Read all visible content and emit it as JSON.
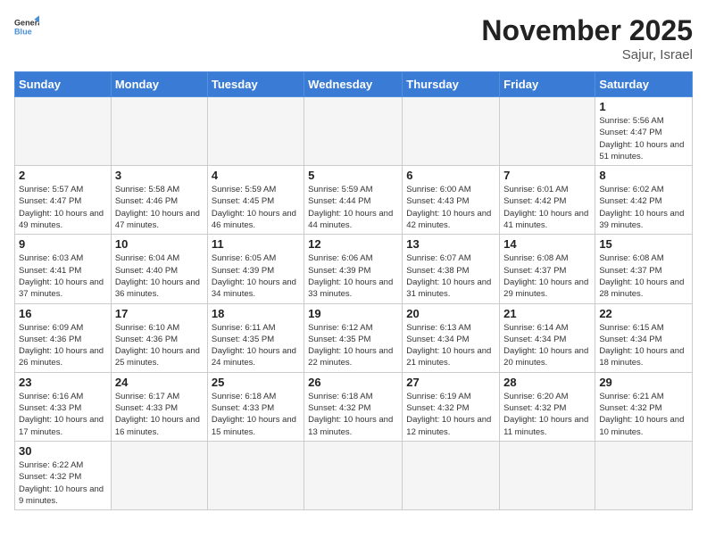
{
  "header": {
    "logo_general": "General",
    "logo_blue": "Blue",
    "month_title": "November 2025",
    "location": "Sajur, Israel"
  },
  "weekdays": [
    "Sunday",
    "Monday",
    "Tuesday",
    "Wednesday",
    "Thursday",
    "Friday",
    "Saturday"
  ],
  "weeks": [
    [
      {
        "day": "",
        "info": ""
      },
      {
        "day": "",
        "info": ""
      },
      {
        "day": "",
        "info": ""
      },
      {
        "day": "",
        "info": ""
      },
      {
        "day": "",
        "info": ""
      },
      {
        "day": "",
        "info": ""
      },
      {
        "day": "1",
        "info": "Sunrise: 5:56 AM\nSunset: 4:47 PM\nDaylight: 10 hours and 51 minutes."
      }
    ],
    [
      {
        "day": "2",
        "info": "Sunrise: 5:57 AM\nSunset: 4:47 PM\nDaylight: 10 hours and 49 minutes."
      },
      {
        "day": "3",
        "info": "Sunrise: 5:58 AM\nSunset: 4:46 PM\nDaylight: 10 hours and 47 minutes."
      },
      {
        "day": "4",
        "info": "Sunrise: 5:59 AM\nSunset: 4:45 PM\nDaylight: 10 hours and 46 minutes."
      },
      {
        "day": "5",
        "info": "Sunrise: 5:59 AM\nSunset: 4:44 PM\nDaylight: 10 hours and 44 minutes."
      },
      {
        "day": "6",
        "info": "Sunrise: 6:00 AM\nSunset: 4:43 PM\nDaylight: 10 hours and 42 minutes."
      },
      {
        "day": "7",
        "info": "Sunrise: 6:01 AM\nSunset: 4:42 PM\nDaylight: 10 hours and 41 minutes."
      },
      {
        "day": "8",
        "info": "Sunrise: 6:02 AM\nSunset: 4:42 PM\nDaylight: 10 hours and 39 minutes."
      }
    ],
    [
      {
        "day": "9",
        "info": "Sunrise: 6:03 AM\nSunset: 4:41 PM\nDaylight: 10 hours and 37 minutes."
      },
      {
        "day": "10",
        "info": "Sunrise: 6:04 AM\nSunset: 4:40 PM\nDaylight: 10 hours and 36 minutes."
      },
      {
        "day": "11",
        "info": "Sunrise: 6:05 AM\nSunset: 4:39 PM\nDaylight: 10 hours and 34 minutes."
      },
      {
        "day": "12",
        "info": "Sunrise: 6:06 AM\nSunset: 4:39 PM\nDaylight: 10 hours and 33 minutes."
      },
      {
        "day": "13",
        "info": "Sunrise: 6:07 AM\nSunset: 4:38 PM\nDaylight: 10 hours and 31 minutes."
      },
      {
        "day": "14",
        "info": "Sunrise: 6:08 AM\nSunset: 4:37 PM\nDaylight: 10 hours and 29 minutes."
      },
      {
        "day": "15",
        "info": "Sunrise: 6:08 AM\nSunset: 4:37 PM\nDaylight: 10 hours and 28 minutes."
      }
    ],
    [
      {
        "day": "16",
        "info": "Sunrise: 6:09 AM\nSunset: 4:36 PM\nDaylight: 10 hours and 26 minutes."
      },
      {
        "day": "17",
        "info": "Sunrise: 6:10 AM\nSunset: 4:36 PM\nDaylight: 10 hours and 25 minutes."
      },
      {
        "day": "18",
        "info": "Sunrise: 6:11 AM\nSunset: 4:35 PM\nDaylight: 10 hours and 24 minutes."
      },
      {
        "day": "19",
        "info": "Sunrise: 6:12 AM\nSunset: 4:35 PM\nDaylight: 10 hours and 22 minutes."
      },
      {
        "day": "20",
        "info": "Sunrise: 6:13 AM\nSunset: 4:34 PM\nDaylight: 10 hours and 21 minutes."
      },
      {
        "day": "21",
        "info": "Sunrise: 6:14 AM\nSunset: 4:34 PM\nDaylight: 10 hours and 20 minutes."
      },
      {
        "day": "22",
        "info": "Sunrise: 6:15 AM\nSunset: 4:34 PM\nDaylight: 10 hours and 18 minutes."
      }
    ],
    [
      {
        "day": "23",
        "info": "Sunrise: 6:16 AM\nSunset: 4:33 PM\nDaylight: 10 hours and 17 minutes."
      },
      {
        "day": "24",
        "info": "Sunrise: 6:17 AM\nSunset: 4:33 PM\nDaylight: 10 hours and 16 minutes."
      },
      {
        "day": "25",
        "info": "Sunrise: 6:18 AM\nSunset: 4:33 PM\nDaylight: 10 hours and 15 minutes."
      },
      {
        "day": "26",
        "info": "Sunrise: 6:18 AM\nSunset: 4:32 PM\nDaylight: 10 hours and 13 minutes."
      },
      {
        "day": "27",
        "info": "Sunrise: 6:19 AM\nSunset: 4:32 PM\nDaylight: 10 hours and 12 minutes."
      },
      {
        "day": "28",
        "info": "Sunrise: 6:20 AM\nSunset: 4:32 PM\nDaylight: 10 hours and 11 minutes."
      },
      {
        "day": "29",
        "info": "Sunrise: 6:21 AM\nSunset: 4:32 PM\nDaylight: 10 hours and 10 minutes."
      }
    ],
    [
      {
        "day": "30",
        "info": "Sunrise: 6:22 AM\nSunset: 4:32 PM\nDaylight: 10 hours and 9 minutes."
      },
      {
        "day": "",
        "info": ""
      },
      {
        "day": "",
        "info": ""
      },
      {
        "day": "",
        "info": ""
      },
      {
        "day": "",
        "info": ""
      },
      {
        "day": "",
        "info": ""
      },
      {
        "day": "",
        "info": ""
      }
    ]
  ]
}
